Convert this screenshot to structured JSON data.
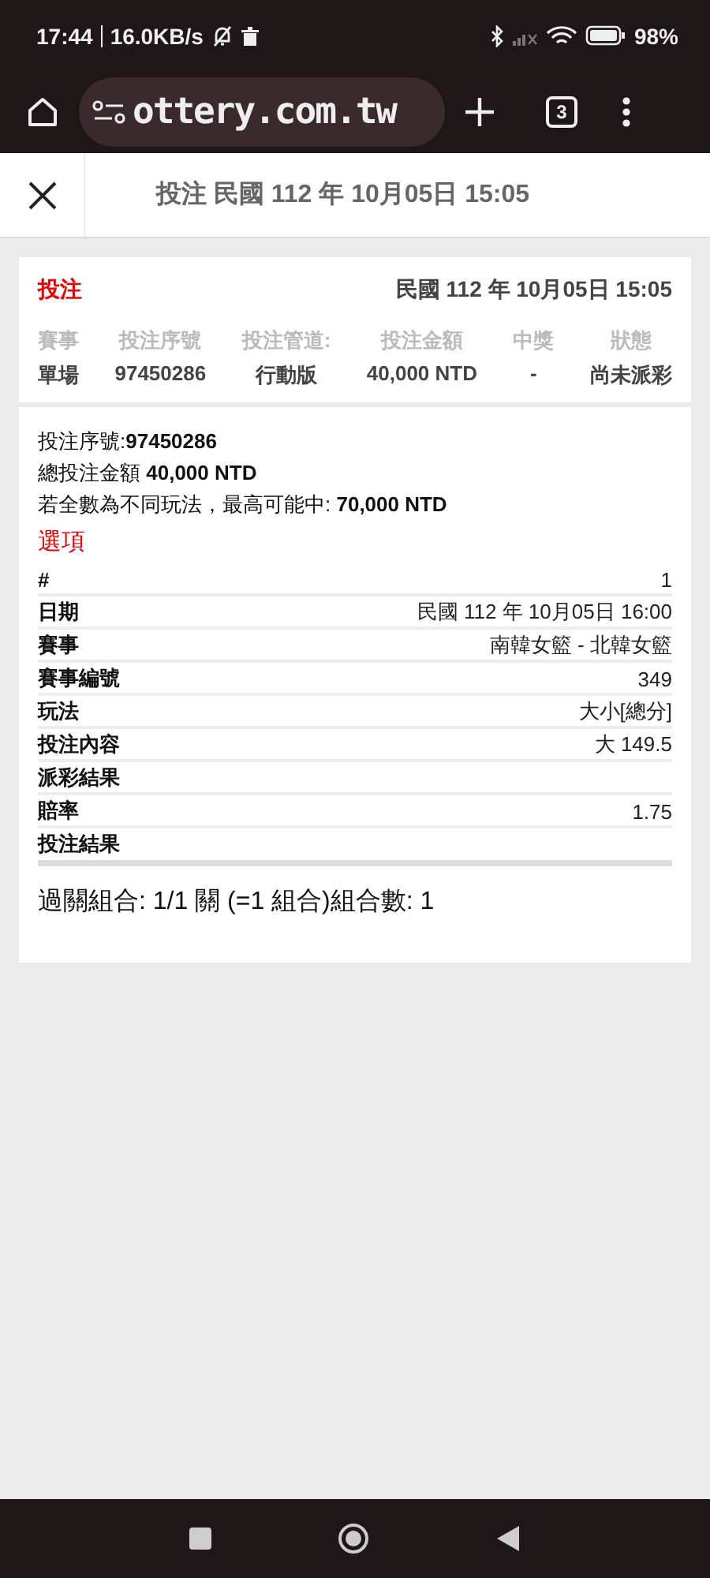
{
  "status_bar": {
    "time": "17:44",
    "speed": "16.0KB/s",
    "battery": "98%"
  },
  "browser": {
    "url": "ottery.com.tw",
    "tab_count": "3"
  },
  "header": {
    "title": "投注 民國 112 年 10月05日 15:05"
  },
  "bet": {
    "label": "投注",
    "datetime": "民國 112 年 10月05日 15:05",
    "columns": [
      "賽事",
      "投注序號",
      "投注管道:",
      "投注金額",
      "中獎",
      "狀態"
    ],
    "values": [
      "單場",
      "97450286",
      "行動版",
      "40,000 NTD",
      "-",
      "尚未派彩"
    ]
  },
  "details": {
    "lines": [
      "投注序號:**97450286**",
      "總投注金額 **40,000 NTD**",
      "若全數為不同玩法，最高可能中: **70,000 NTD**"
    ],
    "section_title": "選項",
    "rows": [
      {
        "label": "#",
        "value": "1"
      },
      {
        "label": "日期",
        "value": "民國 112 年 10月05日 16:00"
      },
      {
        "label": "賽事",
        "value": "南韓女籃 - 北韓女籃"
      },
      {
        "label": "賽事編號",
        "value": "349"
      },
      {
        "label": "玩法",
        "value": "大小[總分]"
      },
      {
        "label": "投注內容",
        "value": "大 149.5"
      },
      {
        "label": "派彩結果"
      },
      {
        "label": "賠率",
        "value": "1.75"
      },
      {
        "label": "投注結果"
      }
    ],
    "summary": "過關組合: 1/1 關 (=1 組合)組合數: 1"
  }
}
